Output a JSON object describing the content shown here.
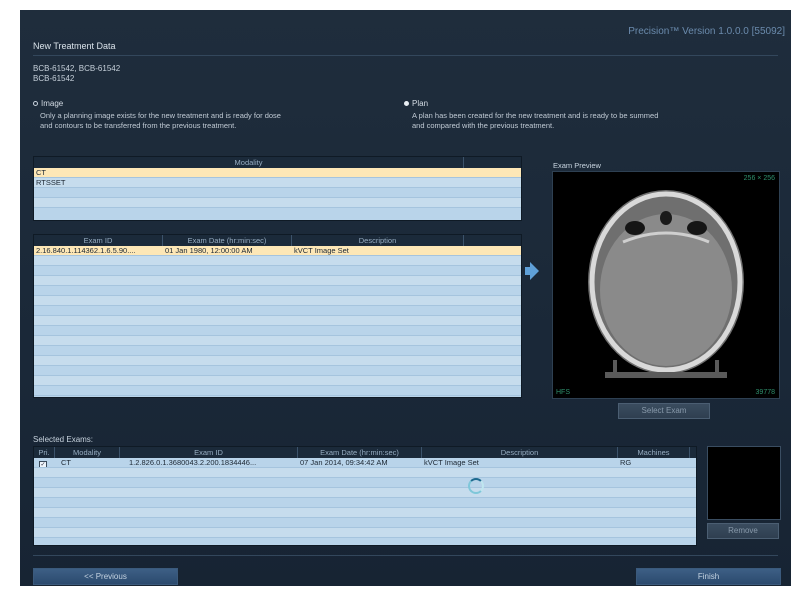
{
  "app": {
    "version": "Precision™ Version 1.0.0.0 [55092]",
    "title": "New Treatment Data"
  },
  "patient": {
    "line1": "BCB-61542, BCB-61542",
    "line2": "BCB-61542"
  },
  "options": {
    "image": {
      "label": "Image",
      "selected": false,
      "desc1": "Only a planning image exists for the new treatment and is ready for dose",
      "desc2": "and contours to be transferred from the previous treatment."
    },
    "plan": {
      "label": "Plan",
      "selected": true,
      "desc1": "A plan has been created for the new treatment and is ready to be summed",
      "desc2": "and compared with the previous treatment."
    }
  },
  "modality_table": {
    "header": "Modality",
    "rows": [
      "CT",
      "RTSSET"
    ]
  },
  "exam_table": {
    "headers": [
      "Exam ID",
      "Exam Date (hr:min:sec)",
      "Description"
    ],
    "rows": [
      {
        "id": "2.16.840.1.114362.1.6.5.90....",
        "date": "01 Jan 1980, 12:00:00 AM",
        "desc": "kVCT Image Set"
      }
    ]
  },
  "preview": {
    "label": "Exam Preview",
    "dims": "256 × 256",
    "orientation": "HFS",
    "slice": "39778"
  },
  "buttons": {
    "select_exam": "Select Exam",
    "remove": "Remove",
    "previous": "<< Previous",
    "finish": "Finish"
  },
  "selected_exams": {
    "label": "Selected Exams:",
    "headers": [
      "Pri.",
      "Modality",
      "Exam ID",
      "Exam Date (hr:min:sec)",
      "Description",
      "Machines"
    ],
    "rows": [
      {
        "primary": "✓",
        "modality": "CT",
        "id": "1.2.826.0.1.3680043.2.200.1834446...",
        "date": "07 Jan 2014, 09:34:42 AM",
        "desc": "kVCT Image Set",
        "machines": "RG"
      }
    ]
  },
  "colors": {
    "background": "#1b2939",
    "table_row": "#b9d4ea",
    "selected_row": "#fde7b6",
    "accent": "#5fa0d8"
  }
}
